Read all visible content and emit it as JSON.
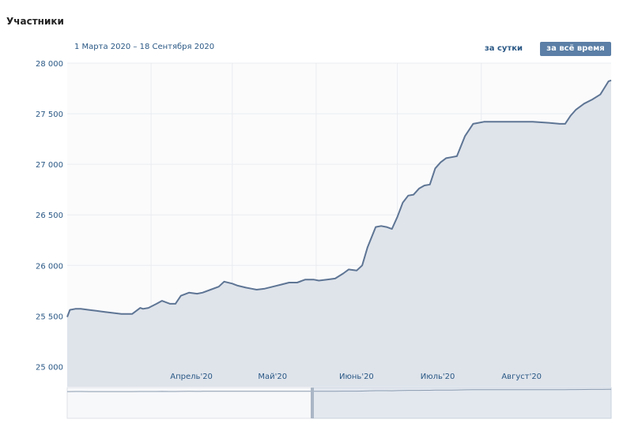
{
  "header": {
    "title": "Участники",
    "date_range": "1 Марта 2020 – 18 Сентября 2020"
  },
  "toolbar": {
    "daily_label": "за сутки",
    "all_time_label": "за всё время",
    "active": "all_time"
  },
  "colors": {
    "line": "#5e7594",
    "fill": "#dfe4eb",
    "grid": "#e9ecf0",
    "tick_text": "#2a5885",
    "button_active_bg": "#5b7fa6"
  },
  "chart_data": {
    "type": "area",
    "title": "Участники",
    "ylim": [
      24800,
      28000
    ],
    "yticks": [
      25000,
      25500,
      26000,
      26500,
      27000,
      27500,
      28000
    ],
    "ytick_labels": [
      "25 000",
      "25 500",
      "26 000",
      "26 500",
      "27 000",
      "27 500",
      "28 000"
    ],
    "xticks": [
      "2020-04-01",
      "2020-05-01",
      "2020-06-01",
      "2020-07-01",
      "2020-08-01"
    ],
    "xtick_labels": [
      "Апрель'20",
      "Май'20",
      "Июнь'20",
      "Июль'20",
      "Август'20"
    ],
    "grid": true,
    "series": [
      {
        "x": [
          "2020-03-01",
          "2020-03-02",
          "2020-03-04",
          "2020-03-06",
          "2020-03-09",
          "2020-03-12",
          "2020-03-15",
          "2020-03-18",
          "2020-03-21",
          "2020-03-25",
          "2020-03-28",
          "2020-03-29",
          "2020-03-31",
          "2020-04-03",
          "2020-04-05",
          "2020-04-08",
          "2020-04-10",
          "2020-04-12",
          "2020-04-15",
          "2020-04-18",
          "2020-04-20",
          "2020-04-23",
          "2020-04-26",
          "2020-04-28",
          "2020-05-01",
          "2020-05-03",
          "2020-05-06",
          "2020-05-08",
          "2020-05-10",
          "2020-05-13",
          "2020-05-16",
          "2020-05-19",
          "2020-05-22",
          "2020-05-25",
          "2020-05-28",
          "2020-05-31",
          "2020-06-02",
          "2020-06-05",
          "2020-06-08",
          "2020-06-11",
          "2020-06-13",
          "2020-06-16",
          "2020-06-18",
          "2020-06-20",
          "2020-06-23",
          "2020-06-25",
          "2020-06-27",
          "2020-06-29",
          "2020-07-01",
          "2020-07-03",
          "2020-07-05",
          "2020-07-07",
          "2020-07-09",
          "2020-07-11",
          "2020-07-13",
          "2020-07-15",
          "2020-07-17",
          "2020-07-19",
          "2020-07-21",
          "2020-07-23",
          "2020-07-26",
          "2020-07-29",
          "2020-07-31",
          "2020-08-02",
          "2020-08-04",
          "2020-08-07",
          "2020-08-12",
          "2020-08-20",
          "2020-08-26",
          "2020-08-30",
          "2020-09-01",
          "2020-09-03",
          "2020-09-05",
          "2020-09-08",
          "2020-09-11",
          "2020-09-14",
          "2020-09-17",
          "2020-09-18"
        ],
        "y": [
          25490,
          25560,
          25570,
          25570,
          25560,
          25550,
          25540,
          25530,
          25520,
          25520,
          25580,
          25570,
          25580,
          25620,
          25650,
          25620,
          25620,
          25700,
          25730,
          25720,
          25730,
          25760,
          25790,
          25840,
          25820,
          25800,
          25780,
          25770,
          25760,
          25770,
          25790,
          25810,
          25830,
          25830,
          25860,
          25860,
          25850,
          25860,
          25870,
          25920,
          25960,
          25950,
          26000,
          26180,
          26380,
          26390,
          26380,
          26360,
          26480,
          26620,
          26690,
          26700,
          26760,
          26790,
          26800,
          26960,
          27020,
          27060,
          27070,
          27080,
          27280,
          27400,
          27410,
          27420,
          27420,
          27420,
          27420,
          27420,
          27410,
          27400,
          27400,
          27480,
          27540,
          27600,
          27640,
          27690,
          27820,
          27830
        ]
      }
    ]
  }
}
